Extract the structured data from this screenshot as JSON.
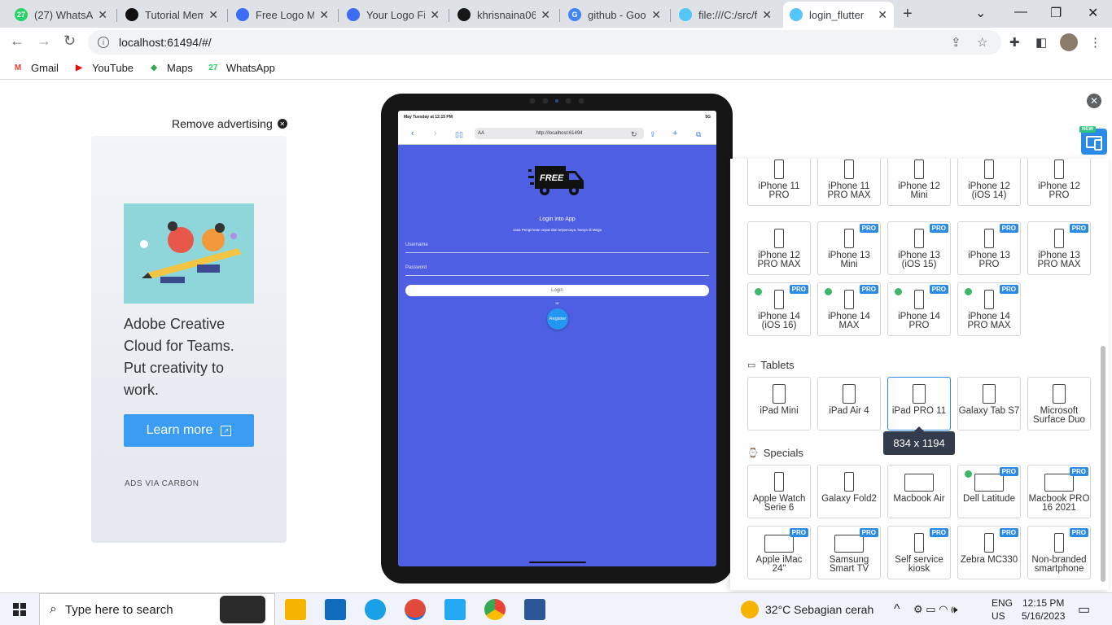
{
  "browser": {
    "tabs": [
      {
        "title": "(27) WhatsApp",
        "fav_color": "#25d366",
        "fav_text": "27"
      },
      {
        "title": "Tutorial Mem",
        "fav_color": "#111111",
        "fav_text": ""
      },
      {
        "title": "Free Logo Ma",
        "fav_color": "#3b6cf3",
        "fav_text": ""
      },
      {
        "title": "Your Logo File",
        "fav_color": "#3b6cf3",
        "fav_text": ""
      },
      {
        "title": "khrisnaina06/",
        "fav_color": "#181717",
        "fav_text": ""
      },
      {
        "title": "github - Goog",
        "fav_color": "#4285f4",
        "fav_text": "G"
      },
      {
        "title": "file:///C:/src/f",
        "fav_color": "#54c5f8",
        "fav_text": ""
      },
      {
        "title": "login_flutter",
        "fav_color": "#54c5f8",
        "fav_text": "",
        "active": true
      }
    ],
    "new_tab": "+",
    "url": "localhost:61494/#/",
    "bookmarks": [
      {
        "label": "Gmail",
        "icon": "gmail-icon",
        "color": "#ea4335",
        "glyph": "M"
      },
      {
        "label": "YouTube",
        "icon": "youtube-icon",
        "color": "#ff0000",
        "glyph": "▶"
      },
      {
        "label": "Maps",
        "icon": "maps-icon",
        "color": "#34a853",
        "glyph": "◆"
      },
      {
        "label": "WhatsApp",
        "icon": "whatsapp-icon",
        "color": "#25d366",
        "glyph": "27"
      }
    ]
  },
  "ad": {
    "remove_label": "Remove advertising",
    "text": "Adobe Creative Cloud for Teams. Put creativity to work.",
    "button": "Learn more",
    "footer": "ADS VIA CARBON"
  },
  "ipad_app": {
    "status_time": "May Tuesday at 12:15 PM",
    "status_right": "5G",
    "safari_aa": "AA",
    "safari_url": "http://localhost:61494",
    "logo_text": "FREE",
    "title": "Login into App",
    "subtitle": "Jasa Pengiriman cepat dan terpercaya, hanya di Mega",
    "username_label": "Username",
    "password_label": "Password",
    "login_button": "Login",
    "or_text": "or",
    "register_button": "Register"
  },
  "device_panel": {
    "rows": [
      [
        {
          "name": "iPhone 11 PRO",
          "pro": false,
          "dot": false
        },
        {
          "name": "iPhone 11 PRO MAX",
          "pro": false,
          "dot": false
        },
        {
          "name": "iPhone 12 Mini",
          "pro": false,
          "dot": false
        },
        {
          "name": "iPhone 12 (iOS 14)",
          "pro": false,
          "dot": false
        },
        {
          "name": "iPhone 12 PRO",
          "pro": false,
          "dot": false
        }
      ],
      [
        {
          "name": "iPhone 12 PRO MAX",
          "pro": false,
          "dot": false
        },
        {
          "name": "iPhone 13 Mini",
          "pro": true,
          "dot": false
        },
        {
          "name": "iPhone 13 (iOS 15)",
          "pro": true,
          "dot": false
        },
        {
          "name": "iPhone 13 PRO",
          "pro": true,
          "dot": false
        },
        {
          "name": "iPhone 13 PRO MAX",
          "pro": true,
          "dot": false
        }
      ],
      [
        {
          "name": "iPhone 14 (iOS 16)",
          "pro": true,
          "dot": true
        },
        {
          "name": "iPhone 14 MAX",
          "pro": true,
          "dot": true
        },
        {
          "name": "iPhone 14 PRO",
          "pro": true,
          "dot": true
        },
        {
          "name": "iPhone 14 PRO MAX",
          "pro": true,
          "dot": true
        }
      ]
    ],
    "tablets_label": "Tablets",
    "tablets": [
      {
        "name": "iPad Mini",
        "pro": false,
        "selected": false
      },
      {
        "name": "iPad Air 4",
        "pro": false,
        "selected": false
      },
      {
        "name": "iPad PRO 11",
        "pro": false,
        "selected": true
      },
      {
        "name": "Galaxy Tab S7",
        "pro": false,
        "selected": false
      },
      {
        "name": "Microsoft Surface Duo",
        "pro": false,
        "selected": false
      }
    ],
    "tooltip": "834 x 1194",
    "specials_label": "Specials",
    "specials_row1": [
      {
        "name": "Apple Watch Serie 6",
        "pro": false,
        "dot": false
      },
      {
        "name": "Galaxy Fold2",
        "pro": false,
        "dot": false
      },
      {
        "name": "Macbook Air",
        "pro": false,
        "dot": false
      },
      {
        "name": "Dell Latitude",
        "pro": true,
        "dot": true
      },
      {
        "name": "Macbook PRO 16 2021",
        "pro": true,
        "dot": false
      }
    ],
    "specials_row2": [
      {
        "name": "Apple iMac 24\"",
        "pro": true,
        "dot": false
      },
      {
        "name": "Samsung Smart TV",
        "pro": true,
        "dot": false
      },
      {
        "name": "Self service kiosk",
        "pro": true,
        "dot": false
      },
      {
        "name": "Zebra MC330",
        "pro": true,
        "dot": false
      },
      {
        "name": "Non-branded smartphone",
        "pro": true,
        "dot": false
      }
    ],
    "pro_badge": "PRO",
    "new_badge": "NEW"
  },
  "taskbar": {
    "search_placeholder": "Type here to search",
    "weather": "32°C  Sebagian cerah",
    "lang_top": "ENG",
    "lang_bottom": "US",
    "time": "12:15 PM",
    "date": "5/16/2023"
  }
}
